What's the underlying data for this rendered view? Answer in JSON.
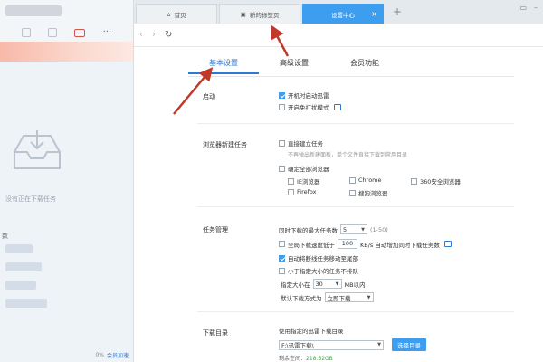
{
  "left_panel": {
    "empty_text": "没有正在下载任务",
    "section_label": "数",
    "footer_percent": "0%",
    "footer_link": "会员加速"
  },
  "tabs": [
    {
      "label": "首页"
    },
    {
      "label": "新的标签页"
    },
    {
      "label": "设置中心"
    }
  ],
  "settings_tabs": [
    "基本设置",
    "高级设置",
    "会员功能"
  ],
  "startup": {
    "label": "启动",
    "options": [
      {
        "label": "开机时启动迅雷",
        "checked": true
      },
      {
        "label": "开启免打扰模式",
        "checked": false
      }
    ]
  },
  "browser_tasks": {
    "label": "浏览器新建任务",
    "direct_label": "直接建立任务",
    "direct_note": "不再弹出新建面板，单个文件直接下载到常用目录",
    "monitor_label": "确定全部浏览器",
    "browsers": [
      "IE浏览器",
      "Chrome",
      "360安全浏览器",
      "Firefox",
      "搜狗浏览器"
    ]
  },
  "task_management": {
    "label": "任务管理",
    "max_tasks_label": "同时下载的最大任务数",
    "max_tasks_value": "5",
    "max_tasks_range": "(1-50)",
    "speed_label": "全局下载速度低于",
    "speed_value": "100",
    "speed_suffix": "KB/s 自动增加同时下载任务数",
    "auto_move_label": "自动将断线任务移动至尾部",
    "small_first_label": "小于指定大小的任务不排队",
    "size_label": "指定大小在",
    "size_value": "30",
    "size_suffix": "MB以内",
    "default_mode_label": "默认下载方式为",
    "default_mode_value": "立即下载"
  },
  "download_dir": {
    "label": "下载目录",
    "use_label": "使用指定的迅雷下载目录",
    "path_value": "F:\\迅雷下载\\",
    "choose_button": "选择目录",
    "free_space_label": "剩余空间：",
    "free_space_value": "218.62GB"
  },
  "colors": {
    "accent": "#3d9ef0",
    "arrow": "#c0392b"
  }
}
